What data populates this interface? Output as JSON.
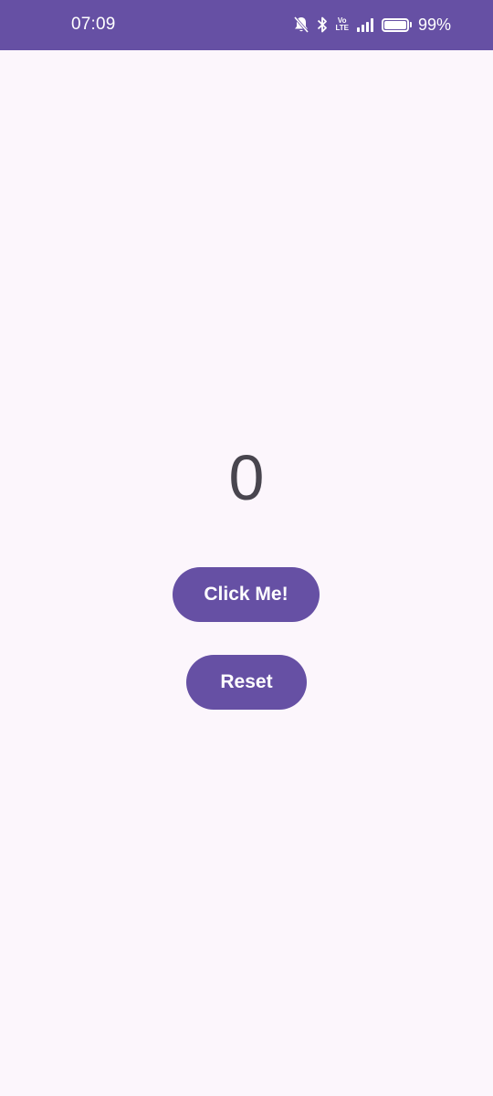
{
  "status_bar": {
    "time": "07:09",
    "volte_top": "Vo",
    "volte_bottom": "LTE",
    "battery_percent": "99%",
    "battery_level": 0.99,
    "icons": [
      "bell-off-icon",
      "bluetooth-icon",
      "volte-icon",
      "signal-icon",
      "battery-icon"
    ],
    "background_color": "#6650a4"
  },
  "main": {
    "counter_value": "0",
    "click_button_label": "Click Me!",
    "reset_button_label": "Reset",
    "accent_color": "#6650a4",
    "background_color": "#fcf6fc"
  }
}
